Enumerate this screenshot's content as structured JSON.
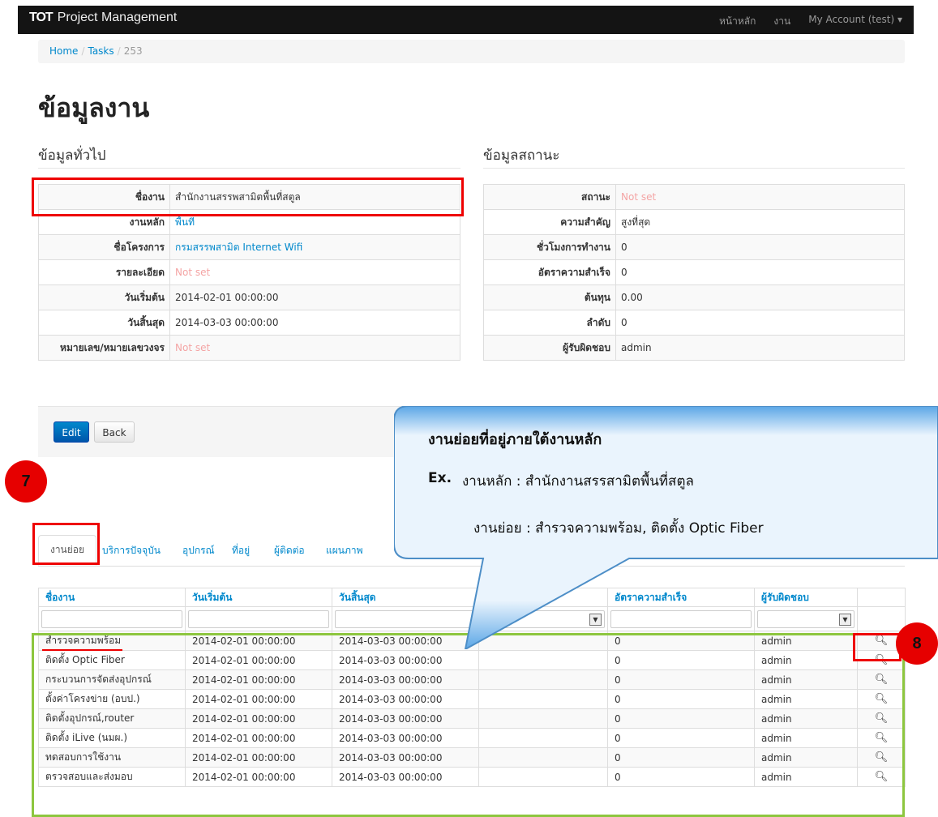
{
  "navbar": {
    "logo": "TOT",
    "title": "Project Management",
    "links": [
      "หน้าหลัก",
      "งาน",
      "My Account (test) ▾"
    ]
  },
  "breadcrumb": {
    "home": "Home",
    "tasks": "Tasks",
    "current": "253"
  },
  "page_title": "ข้อมูลงาน",
  "general": {
    "title": "ข้อมูลทั่วไป",
    "rows": [
      {
        "label": "ชื่องาน",
        "value": "สำนักงานสรรพสามิตพื้นที่สตูล"
      },
      {
        "label": "งานหลัก",
        "value": "พื้นที่"
      },
      {
        "label": "ชื่อโครงการ",
        "value": "กรมสรรพสามิต Internet Wifi"
      },
      {
        "label": "รายละเอียด",
        "value": "Not set"
      },
      {
        "label": "วันเริ่มต้น",
        "value": "2014-02-01 00:00:00"
      },
      {
        "label": "วันสิ้นสุด",
        "value": "2014-03-03 00:00:00"
      },
      {
        "label": "หมายเลข/หมายเลขวงจร",
        "value": "Not set"
      }
    ]
  },
  "status": {
    "title": "ข้อมูลสถานะ",
    "rows": [
      {
        "label": "สถานะ",
        "value": "Not set"
      },
      {
        "label": "ความสำคัญ",
        "value": "สูงที่สุด"
      },
      {
        "label": "ชั่วโมงการทำงาน",
        "value": "0"
      },
      {
        "label": "อัตราความสำเร็จ",
        "value": "0"
      },
      {
        "label": "ต้นทุน",
        "value": "0.00"
      },
      {
        "label": "ลำดับ",
        "value": "0"
      },
      {
        "label": "ผู้รับผิดชอบ",
        "value": "admin"
      }
    ]
  },
  "buttons": {
    "edit": "Edit",
    "back": "Back"
  },
  "tabs": [
    "งานย่อย",
    "บริการปัจจุบัน",
    "อุปกรณ์",
    "ที่อยู่",
    "ผู้ติดต่อ",
    "แผนภาพ"
  ],
  "grid": {
    "headers": [
      "ชื่องาน",
      "วันเริ่มต้น",
      "วันสิ้นสุด",
      "",
      "อัตราความสำเร็จ",
      "ผู้รับผิดชอบ",
      ""
    ],
    "rows": [
      [
        "สำรวจความพร้อม",
        "2014-02-01 00:00:00",
        "2014-03-03 00:00:00",
        "",
        "0",
        "admin"
      ],
      [
        "ติดตั้ง Optic Fiber",
        "2014-02-01 00:00:00",
        "2014-03-03 00:00:00",
        "",
        "0",
        "admin"
      ],
      [
        "กระบวนการจัดส่งอุปกรณ์",
        "2014-02-01 00:00:00",
        "2014-03-03 00:00:00",
        "",
        "0",
        "admin"
      ],
      [
        "ตั้งค่าโครงข่าย (อบป.)",
        "2014-02-01 00:00:00",
        "2014-03-03 00:00:00",
        "",
        "0",
        "admin"
      ],
      [
        "ติดตั้งอุปกรณ์,router",
        "2014-02-01 00:00:00",
        "2014-03-03 00:00:00",
        "",
        "0",
        "admin"
      ],
      [
        "ติดตั้ง iLive (นมผ.)",
        "2014-02-01 00:00:00",
        "2014-03-03 00:00:00",
        "",
        "0",
        "admin"
      ],
      [
        "ทดสอบการใช้งาน",
        "2014-02-01 00:00:00",
        "2014-03-03 00:00:00",
        "",
        "0",
        "admin"
      ],
      [
        "ตรวจสอบและส่งมอบ",
        "2014-02-01 00:00:00",
        "2014-03-03 00:00:00",
        "",
        "0",
        "admin"
      ]
    ]
  },
  "callout": {
    "title": "งานย่อยที่อยู่ภายใต้งานหลัก",
    "ex_label": "Ex.",
    "line1": "งานหลัก : สำนักงานสรรสามิตพื้นที่สตูล",
    "line2": "งานย่อย : สำรวจความพร้อม, ติดตั้ง Optic Fiber"
  },
  "badges": {
    "b7": "7",
    "b8": "8"
  },
  "colors": {
    "link": "#0088cc",
    "notset": "#f4a4a4",
    "annotation_red": "#e00000",
    "annotation_green": "#8dc63f",
    "callout": "#7ab8e8"
  },
  "icons": {
    "view": "search-icon"
  }
}
